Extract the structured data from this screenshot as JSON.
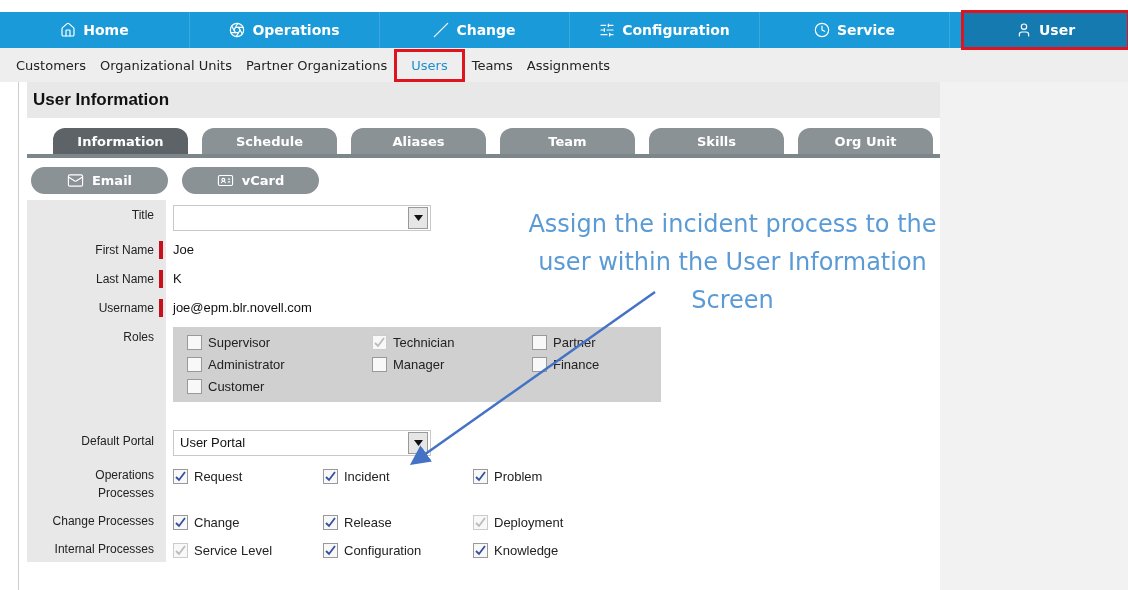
{
  "nav": [
    {
      "label": "Home",
      "selected": false,
      "highlighted": false
    },
    {
      "label": "Operations",
      "selected": false,
      "highlighted": false
    },
    {
      "label": "Change",
      "selected": false,
      "highlighted": false
    },
    {
      "label": "Configuration",
      "selected": false,
      "highlighted": false
    },
    {
      "label": "Service",
      "selected": false,
      "highlighted": false
    },
    {
      "label": "User",
      "selected": true,
      "highlighted": true
    }
  ],
  "subnav": [
    {
      "label": "Customers",
      "selected": false,
      "highlighted": false
    },
    {
      "label": "Organizational Units",
      "selected": false,
      "highlighted": false
    },
    {
      "label": "Partner Organizations",
      "selected": false,
      "highlighted": false
    },
    {
      "label": "Users",
      "selected": true,
      "highlighted": true
    },
    {
      "label": "Teams",
      "selected": false,
      "highlighted": false
    },
    {
      "label": "Assignments",
      "selected": false,
      "highlighted": false
    }
  ],
  "panel": {
    "title": "User Information",
    "tabs": [
      {
        "label": "Information",
        "selected": true
      },
      {
        "label": "Schedule",
        "selected": false
      },
      {
        "label": "Aliases",
        "selected": false
      },
      {
        "label": "Team",
        "selected": false
      },
      {
        "label": "Skills",
        "selected": false
      },
      {
        "label": "Org Unit",
        "selected": false
      }
    ],
    "buttons": [
      "Email",
      "vCard"
    ],
    "form": [
      {
        "kind": "select",
        "label": "Title",
        "required": false
      },
      {
        "kind": "text",
        "label": "First Name",
        "required": true,
        "value": "Joe"
      },
      {
        "kind": "text",
        "label": "Last Name",
        "required": true,
        "value": "K"
      },
      {
        "kind": "text",
        "label": "Username",
        "required": true,
        "value": "joe@epm.blr.novell.com"
      },
      {
        "kind": "roles",
        "label": "Roles",
        "required": false,
        "options": [
          {
            "label": "Supervisor",
            "checked": false,
            "disabled": false
          },
          {
            "label": "Technician",
            "checked": true,
            "disabled": true
          },
          {
            "label": "Partner",
            "checked": false,
            "disabled": false
          },
          {
            "label": "Administrator",
            "checked": false,
            "disabled": false
          },
          {
            "label": "Manager",
            "checked": false,
            "disabled": false
          },
          {
            "label": "Finance",
            "checked": false,
            "disabled": false
          },
          {
            "label": "Customer",
            "checked": false,
            "disabled": false
          }
        ]
      },
      {
        "kind": "select",
        "label": "Default Portal",
        "required": false,
        "value": "User Portal"
      },
      {
        "kind": "checks",
        "label": "Operations Processes",
        "required": false,
        "options": [
          {
            "label": "Request",
            "checked": true,
            "disabled": false
          },
          {
            "label": "Incident",
            "checked": true,
            "disabled": false
          },
          {
            "label": "Problem",
            "checked": true,
            "disabled": false
          }
        ]
      },
      {
        "kind": "checks",
        "label": "Change Processes",
        "required": false,
        "options": [
          {
            "label": "Change",
            "checked": true,
            "disabled": false
          },
          {
            "label": "Release",
            "checked": true,
            "disabled": false
          },
          {
            "label": "Deployment",
            "checked": true,
            "disabled": true
          }
        ]
      },
      {
        "kind": "checks",
        "label": "Internal Processes",
        "required": false,
        "options": [
          {
            "label": "Service Level",
            "checked": true,
            "disabled": true
          },
          {
            "label": "Configuration",
            "checked": true,
            "disabled": false
          },
          {
            "label": "Knowledge",
            "checked": true,
            "disabled": false
          }
        ]
      }
    ]
  },
  "annotation": {
    "text": "Assign the incident process to the user within the User Information Screen"
  }
}
